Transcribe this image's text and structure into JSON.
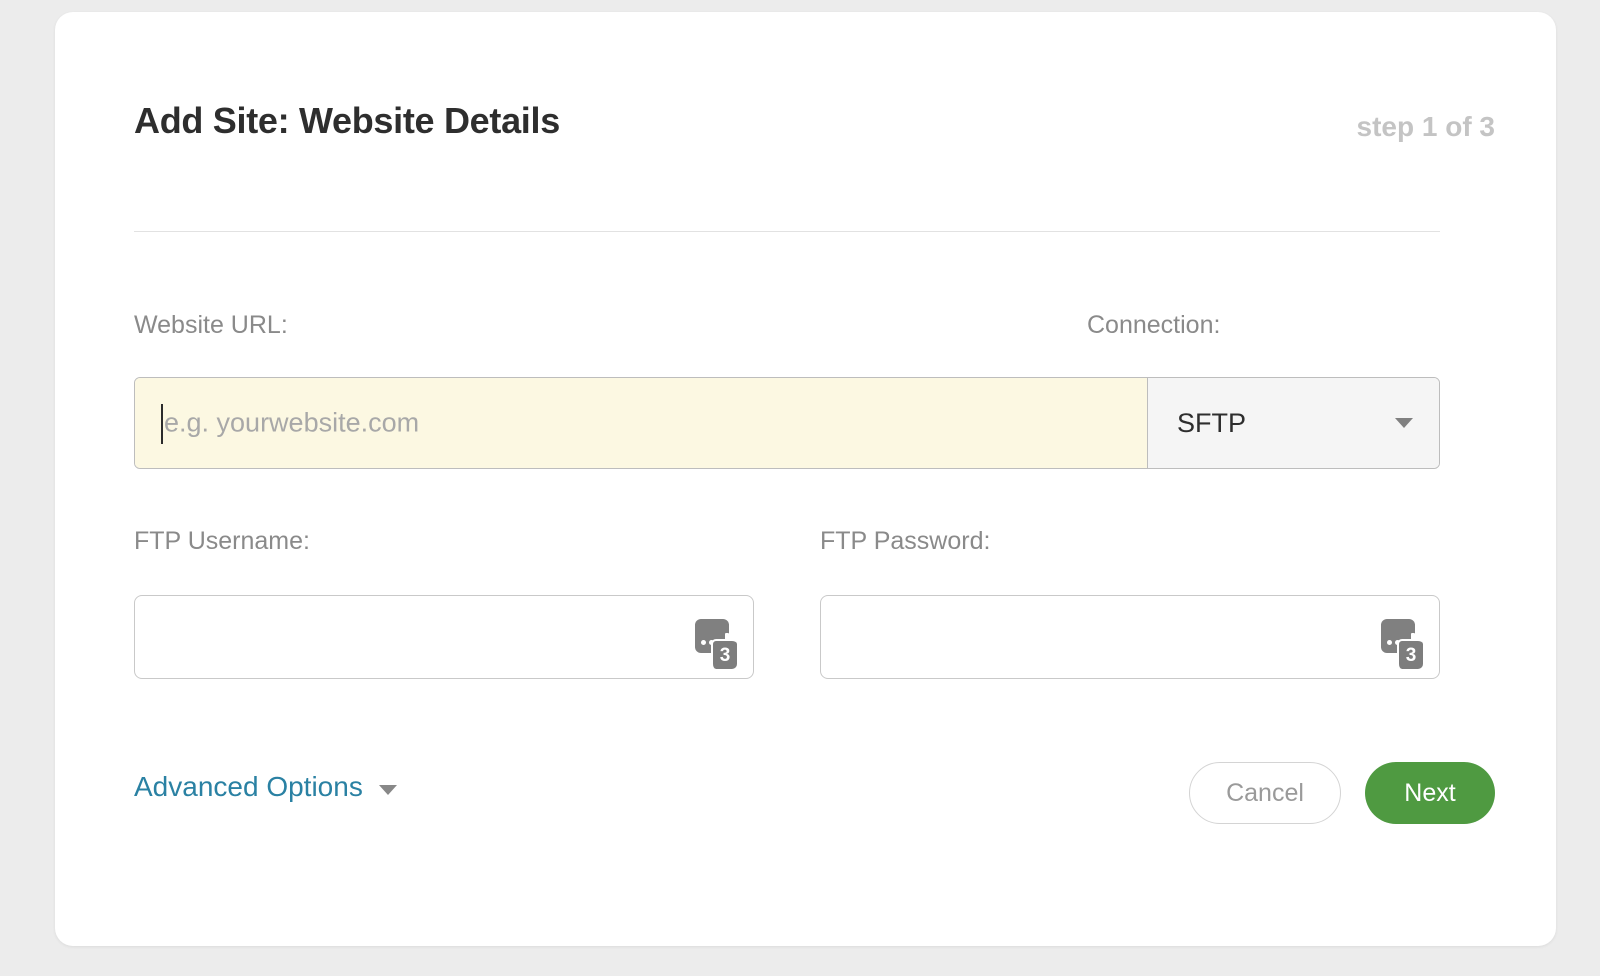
{
  "dialog": {
    "title": "Add Site: Website Details",
    "step": "step 1 of 3"
  },
  "fields": {
    "website_url": {
      "label": "Website URL:",
      "placeholder": "e.g. yourwebsite.com",
      "value": ""
    },
    "connection": {
      "label": "Connection:",
      "selected": "SFTP"
    },
    "ftp_username": {
      "label": "FTP Username:",
      "value": ""
    },
    "ftp_password": {
      "label": "FTP Password:",
      "value": ""
    }
  },
  "password_manager_icon": {
    "name": "password-manager-icon",
    "badge_count": "3"
  },
  "advanced": {
    "label": "Advanced Options"
  },
  "buttons": {
    "cancel": "Cancel",
    "next": "Next"
  },
  "colors": {
    "page_background": "#ececec",
    "card_background": "#ffffff",
    "title_text": "#2e2e2e",
    "step_text": "#c4c4c4",
    "label_text": "#8a8a8a",
    "autofill_field": "#fcf8e2",
    "select_background": "#f5f5f5",
    "link_accent": "#2a81a3",
    "primary_button": "#4f9a41",
    "cancel_text": "#9a9a9a",
    "icon_gray": "#808080"
  }
}
